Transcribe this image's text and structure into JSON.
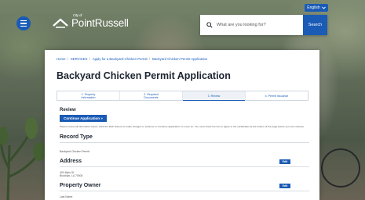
{
  "header": {
    "language_label": "English",
    "logo_prefix": "City of",
    "logo_name": "PointRussell",
    "search_placeholder": "What are you looking for?",
    "search_button": "Search"
  },
  "breadcrumb": [
    "Home",
    "SERVICES",
    "Apply for a Backyard Chicken Permit",
    "Backyard Chicken Permit Application"
  ],
  "page_title": "Backyard Chicken Permit Application",
  "steps": [
    "1. Property\nInformation",
    "2. Required\nDocuments",
    "3. Review",
    "4. Permit Issuance"
  ],
  "review": {
    "label": "Review",
    "continue_button": "Continue Application »",
    "instructions": "Please review all information below. Click the 'Edit' buttons to make changes to sections or 'Continue Application' to move on. You must check the box to agree to the certification at the bottom of the page before you can continue."
  },
  "sections": {
    "record_type": {
      "title": "Record Type",
      "value": "Backyard Chicken Permit"
    },
    "address": {
      "title": "Address",
      "edit": "Edit",
      "line1": "400 Main St",
      "line2": "Brooklyn, LA 70000"
    },
    "property_owner": {
      "title": "Property Owner",
      "edit": "Edit",
      "line1": "Last Name"
    }
  },
  "colors": {
    "primary": "#1a5bb5",
    "title_text": "#1b2430"
  }
}
